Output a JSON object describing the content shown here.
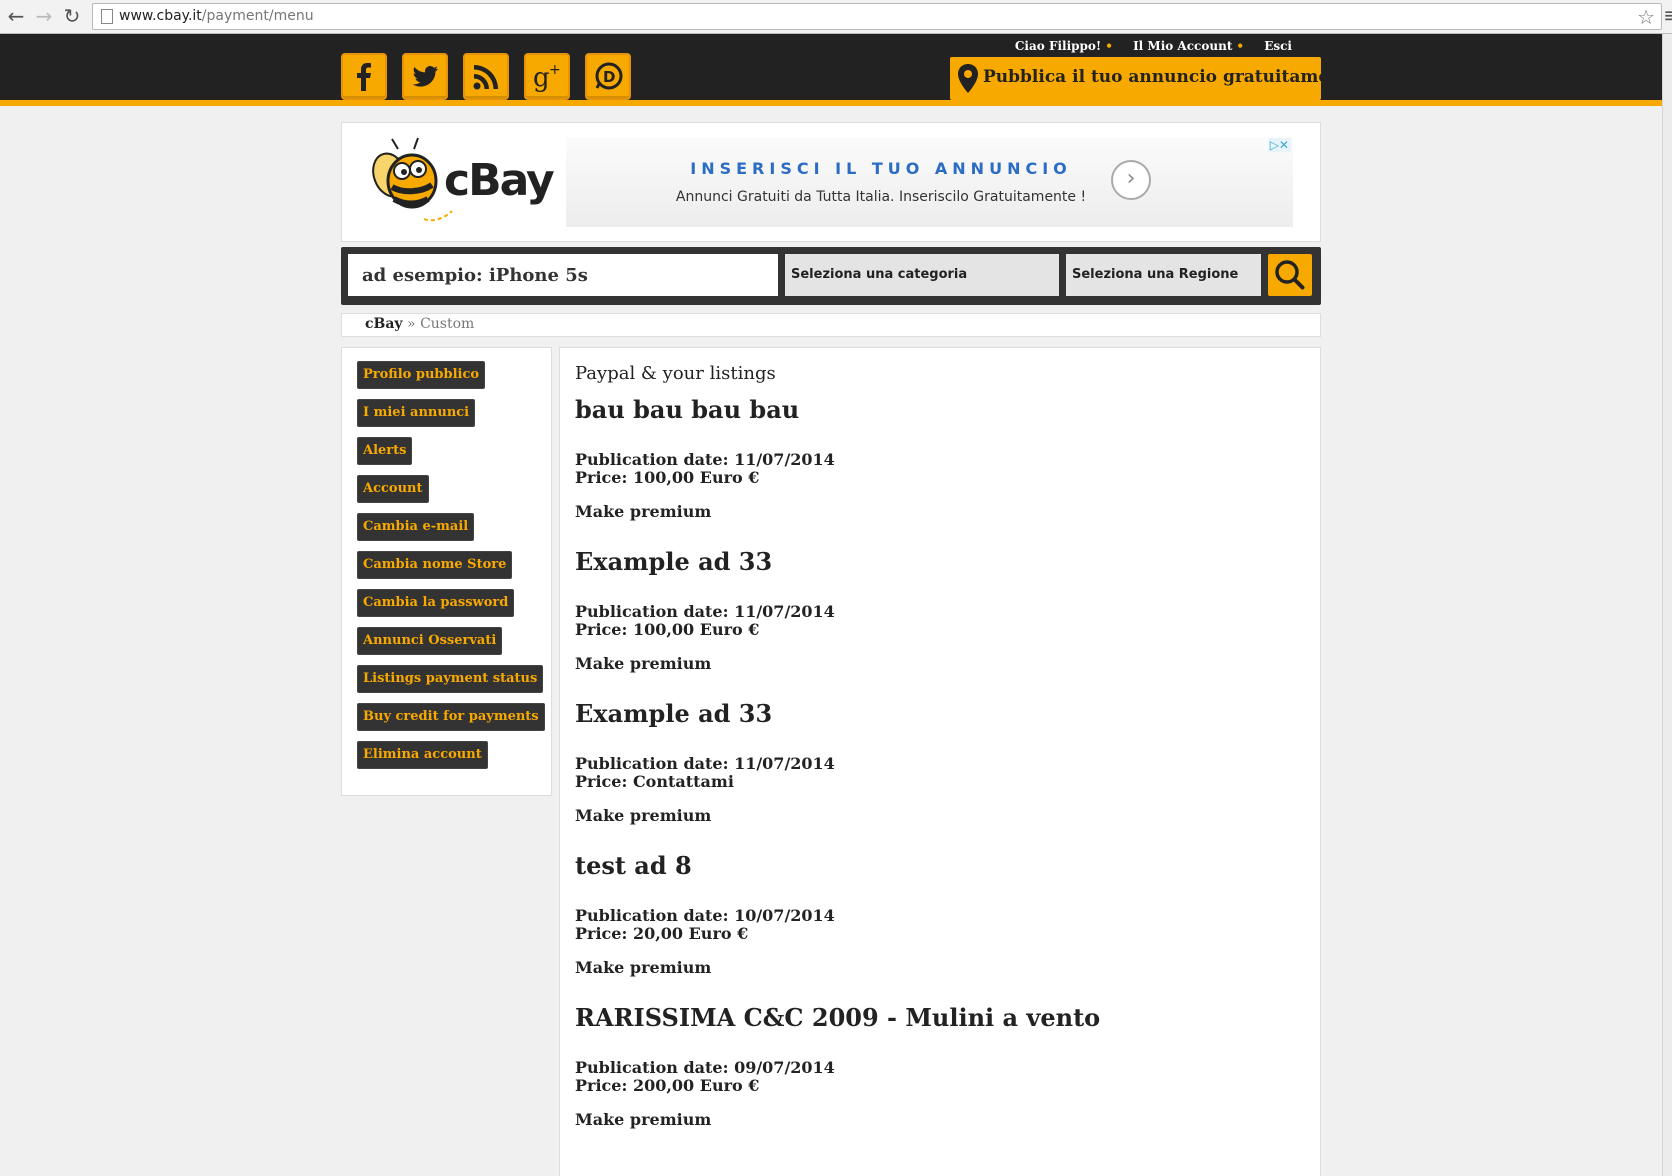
{
  "browser": {
    "url_host": "www.cbay.it",
    "url_path": "/payment/menu"
  },
  "header": {
    "social_icons": [
      "facebook-icon",
      "twitter-icon",
      "rss-icon",
      "google-plus-icon",
      "disqus-icon"
    ],
    "greeting": "Ciao Filippo!",
    "account_link": "Il Mio Account",
    "logout_link": "Esci",
    "publish_label": "Pubblica il tuo annuncio gratuitamente"
  },
  "logo": {
    "text": "cBay"
  },
  "ad": {
    "title": "INSERISCI IL TUO ANNUNCIO",
    "text": "Annunci Gratuiti da Tutta Italia. Inseriscilo Gratuitamente !"
  },
  "search": {
    "placeholder": "ad esempio: iPhone 5s",
    "category_label": "Seleziona una categoria",
    "region_label": "Seleziona una Regione"
  },
  "breadcrumb": {
    "home": "cBay",
    "separator": "»",
    "current": "Custom"
  },
  "sidebar": {
    "items": [
      "Profilo pubblico",
      "I miei annunci",
      "Alerts",
      "Account",
      "Cambia e-mail",
      "Cambia nome Store",
      "Cambia la password",
      "Annunci Osservati",
      "Listings payment status",
      "Buy credit for payments",
      "Elimina account"
    ]
  },
  "main": {
    "title": "Paypal & your listings",
    "listings": [
      {
        "title": "bau bau bau bau",
        "date": "Publication date: 11/07/2014",
        "price": "Price: 100,00 Euro €",
        "action": "Make premium"
      },
      {
        "title": "Example ad 33",
        "date": "Publication date: 11/07/2014",
        "price": "Price: 100,00 Euro €",
        "action": "Make premium"
      },
      {
        "title": "Example ad 33",
        "date": "Publication date: 11/07/2014",
        "price": "Price: Contattami",
        "action": "Make premium"
      },
      {
        "title": "test ad 8",
        "date": "Publication date: 10/07/2014",
        "price": "Price: 20,00 Euro €",
        "action": "Make premium"
      },
      {
        "title": "RARISSIMA C&C 2009 - Mulini a vento",
        "date": "Publication date: 09/07/2014",
        "price": "Price: 200,00 Euro €",
        "action": "Make premium"
      }
    ]
  },
  "colors": {
    "accent": "#f8a900",
    "header_bg": "#222222",
    "sidebar_button_bg": "#333333"
  }
}
